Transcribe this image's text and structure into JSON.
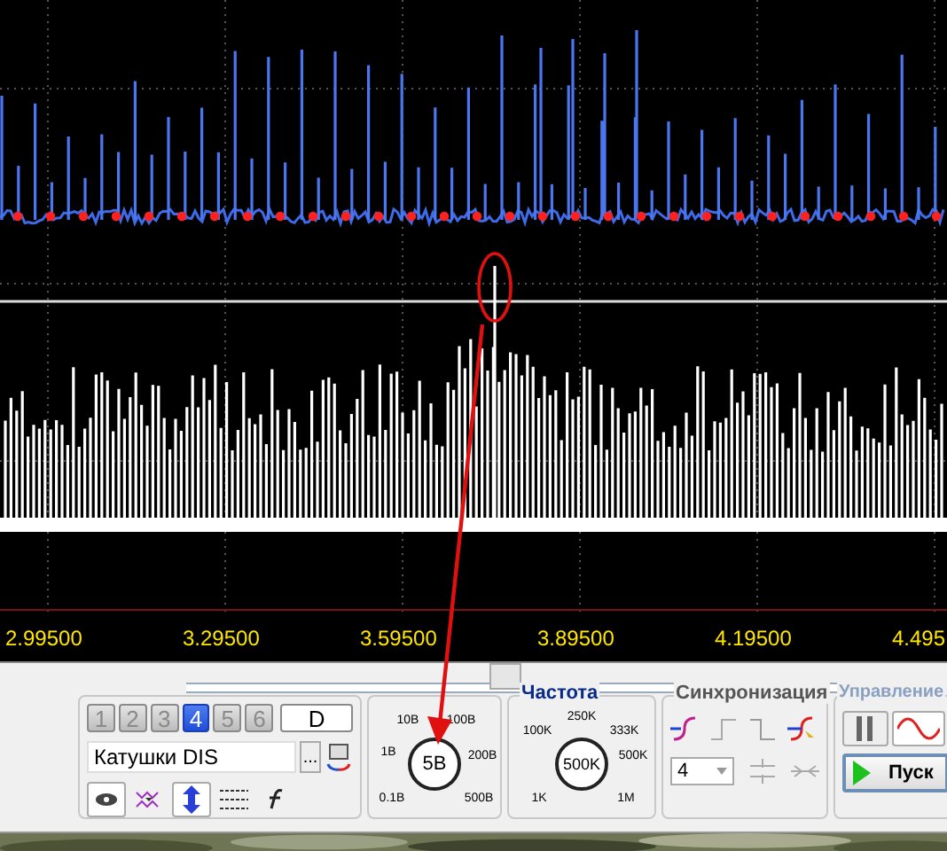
{
  "scope": {
    "axis_labels": [
      "2.99500",
      "3.29500",
      "3.59500",
      "3.89500",
      "4.19500",
      "4.495"
    ]
  },
  "channel_tabs": [
    {
      "label": "1",
      "kind": "channel",
      "selected": false
    },
    {
      "label": "2",
      "kind": "channel",
      "selected": false
    },
    {
      "label": "3",
      "kind": "channel",
      "selected": false
    },
    {
      "label": "4",
      "kind": "channel",
      "selected": true
    },
    {
      "label": "5",
      "kind": "channel",
      "selected": false
    },
    {
      "label": "6",
      "kind": "channel",
      "selected": false
    },
    {
      "label": "D",
      "kind": "digital",
      "selected": false
    }
  ],
  "channel_name": {
    "value": "Катушки DIS",
    "browse": "..."
  },
  "voltage": {
    "value": "5В",
    "scale": [
      "10В",
      "100В",
      "1В",
      "200В",
      "0.1В",
      "500В"
    ]
  },
  "frequency": {
    "title": "Частота",
    "value": "500K",
    "scale": [
      "250K",
      "100K",
      "333K",
      "500K",
      "1K",
      "1M"
    ]
  },
  "sync": {
    "title": "Синхронизация",
    "channel": "4"
  },
  "control": {
    "title": "Управление",
    "start": "Пуск"
  }
}
